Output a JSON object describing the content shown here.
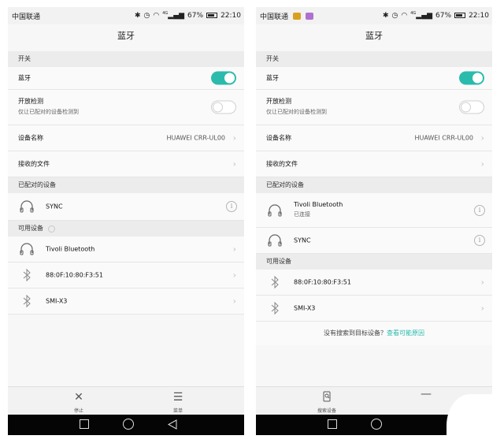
{
  "colors": {
    "accent": "#2bbbad",
    "nav_bar": "#050505",
    "section_bg": "#ececec"
  },
  "left": {
    "status": {
      "carrier": "中国联通",
      "signal": "4G",
      "battery": "67%",
      "time": "22:10"
    },
    "title": "蓝牙",
    "switch_header": "开关",
    "bluetooth": {
      "label": "蓝牙",
      "on": true
    },
    "open_detection": {
      "label": "开放检测",
      "sub": "仅让已配对的设备检测到",
      "on": false
    },
    "device_name": {
      "label": "设备名称",
      "value": "HUAWEI CRR-UL00"
    },
    "received_files": {
      "label": "接收的文件"
    },
    "paired_header": "已配对的设备",
    "paired": [
      {
        "icon": "headphones-icon",
        "name": "SYNC"
      }
    ],
    "available_header": "可用设备",
    "available": [
      {
        "icon": "headphones-icon",
        "name": "Tivoli Bluetooth"
      },
      {
        "icon": "bluetooth-icon",
        "name": "88:0F:10:80:F3:51"
      },
      {
        "icon": "bluetooth-icon",
        "name": "SMI-X3"
      }
    ],
    "bottom": {
      "stop_label": "停止",
      "menu_label": "菜单"
    }
  },
  "right": {
    "status": {
      "carrier": "中国联通",
      "signal": "4G",
      "battery": "67%",
      "time": "22:10"
    },
    "title": "蓝牙",
    "switch_header": "开关",
    "bluetooth": {
      "label": "蓝牙",
      "on": true
    },
    "open_detection": {
      "label": "开放检测",
      "sub": "仅让已配对的设备检测到",
      "on": false
    },
    "device_name": {
      "label": "设备名称",
      "value": "HUAWEI CRR-UL00"
    },
    "received_files": {
      "label": "接收的文件"
    },
    "paired_header": "已配对的设备",
    "paired": [
      {
        "icon": "headphones-icon",
        "name": "Tivoli Bluetooth",
        "status": "已连接"
      },
      {
        "icon": "headphones-icon",
        "name": "SYNC"
      }
    ],
    "available_header": "可用设备",
    "available": [
      {
        "icon": "bluetooth-icon",
        "name": "88:0F:10:80:F3:51"
      },
      {
        "icon": "bluetooth-icon",
        "name": "SMI-X3"
      }
    ],
    "hint": {
      "text": "没有搜索到目标设备？",
      "link": "查看可能原因"
    },
    "bottom": {
      "search_label": "搜索设备"
    }
  }
}
